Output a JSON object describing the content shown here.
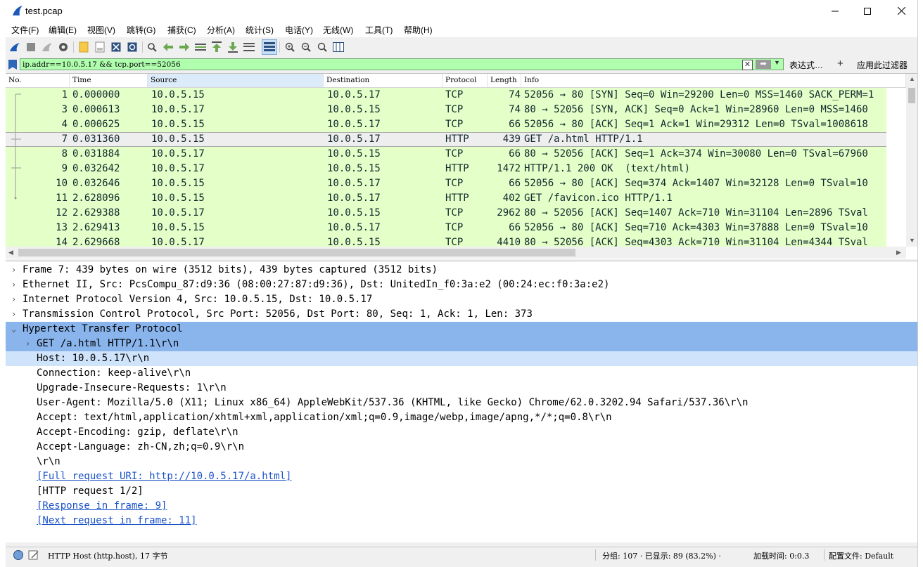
{
  "window": {
    "title": "test.pcap"
  },
  "menu": [
    "文件(F)",
    "编辑(E)",
    "视图(V)",
    "跳转(G)",
    "捕获(C)",
    "分析(A)",
    "统计(S)",
    "电话(Y)",
    "无线(W)",
    "工具(T)",
    "帮助(H)"
  ],
  "toolbar": {
    "icons": [
      "shark-fin-start-icon",
      "stop-square-icon",
      "restart-fin-icon",
      "gear-options-icon",
      "open-folder-icon",
      "save-file-icon",
      "close-file-icon",
      "reload-icon",
      "find-packet-icon",
      "go-back-icon",
      "go-forward-icon",
      "go-to-packet-icon",
      "go-first-icon",
      "go-last-icon",
      "auto-scroll-icon",
      "colorize-icon",
      "zoom-in-icon",
      "zoom-out-icon",
      "zoom-normal-icon",
      "resize-columns-icon"
    ]
  },
  "filter": {
    "value": "ip.addr==10.0.5.17 && tcp.port==52056",
    "expression_label": "表达式…",
    "add_label": "+",
    "apply_label": "应用此过滤器",
    "clear_glyph": "✕",
    "apply_glyph": "➡",
    "dropdown_glyph": "▼"
  },
  "packet_list": {
    "columns": [
      "No.",
      "Time",
      "Source",
      "Destination",
      "Protocol",
      "Length",
      "Info"
    ],
    "rows": [
      {
        "no": "1",
        "time": "0.000000",
        "src": "10.0.5.15",
        "dst": "10.0.5.17",
        "proto": "TCP",
        "len": "74",
        "info": "52056 → 80 [SYN] Seq=0 Win=29200 Len=0 MSS=1460 SACK_PERM=1"
      },
      {
        "no": "3",
        "time": "0.000613",
        "src": "10.0.5.17",
        "dst": "10.0.5.15",
        "proto": "TCP",
        "len": "74",
        "info": "80 → 52056 [SYN, ACK] Seq=0 Ack=1 Win=28960 Len=0 MSS=1460"
      },
      {
        "no": "4",
        "time": "0.000625",
        "src": "10.0.5.15",
        "dst": "10.0.5.17",
        "proto": "TCP",
        "len": "66",
        "info": "52056 → 80 [ACK] Seq=1 Ack=1 Win=29312 Len=0 TSval=1008618"
      },
      {
        "no": "7",
        "time": "0.031360",
        "src": "10.0.5.15",
        "dst": "10.0.5.17",
        "proto": "HTTP",
        "len": "439",
        "info": "GET /a.html HTTP/1.1"
      },
      {
        "no": "8",
        "time": "0.031884",
        "src": "10.0.5.17",
        "dst": "10.0.5.15",
        "proto": "TCP",
        "len": "66",
        "info": "80 → 52056 [ACK] Seq=1 Ack=374 Win=30080 Len=0 TSval=67960"
      },
      {
        "no": "9",
        "time": "0.032642",
        "src": "10.0.5.17",
        "dst": "10.0.5.15",
        "proto": "HTTP",
        "len": "1472",
        "info": "HTTP/1.1 200 OK  (text/html)"
      },
      {
        "no": "10",
        "time": "0.032646",
        "src": "10.0.5.15",
        "dst": "10.0.5.17",
        "proto": "TCP",
        "len": "66",
        "info": "52056 → 80 [ACK] Seq=374 Ack=1407 Win=32128 Len=0 TSval=10"
      },
      {
        "no": "11",
        "time": "2.628096",
        "src": "10.0.5.15",
        "dst": "10.0.5.17",
        "proto": "HTTP",
        "len": "402",
        "info": "GET /favicon.ico HTTP/1.1"
      },
      {
        "no": "12",
        "time": "2.629388",
        "src": "10.0.5.17",
        "dst": "10.0.5.15",
        "proto": "TCP",
        "len": "2962",
        "info": "80 → 52056 [ACK] Seq=1407 Ack=710 Win=31104 Len=2896 TSval"
      },
      {
        "no": "13",
        "time": "2.629413",
        "src": "10.0.5.15",
        "dst": "10.0.5.17",
        "proto": "TCP",
        "len": "66",
        "info": "52056 → 80 [ACK] Seq=710 Ack=4303 Win=37888 Len=0 TSval=10"
      },
      {
        "no": "14",
        "time": "2.629668",
        "src": "10.0.5.17",
        "dst": "10.0.5.15",
        "proto": "TCP",
        "len": "4410",
        "info": "80 → 52056 [ACK] Seq=4303 Ack=710 Win=31104 Len=4344 TSval"
      }
    ],
    "selected_no": "7"
  },
  "details": {
    "lines": [
      {
        "text": "Frame 7: 439 bytes on wire (3512 bits), 439 bytes captured (3512 bits)",
        "chevron": "›",
        "level": 0
      },
      {
        "text": "Ethernet II, Src: PcsCompu_87:d9:36 (08:00:27:87:d9:36), Dst: UnitedIn_f0:3a:e2 (00:24:ec:f0:3a:e2)",
        "chevron": "›",
        "level": 0
      },
      {
        "text": "Internet Protocol Version 4, Src: 10.0.5.15, Dst: 10.0.5.17",
        "chevron": "›",
        "level": 0
      },
      {
        "text": "Transmission Control Protocol, Src Port: 52056, Dst Port: 80, Seq: 1, Ack: 1, Len: 373",
        "chevron": "›",
        "level": 0
      },
      {
        "text": "Hypertext Transfer Protocol",
        "chevron": "⌄",
        "level": 0
      },
      {
        "text": "GET /a.html HTTP/1.1\\r\\n",
        "chevron": "›",
        "level": 1
      },
      {
        "text": "Host: 10.0.5.17\\r\\n",
        "chevron": "",
        "level": 1
      },
      {
        "text": "Connection: keep-alive\\r\\n",
        "chevron": "",
        "level": 1
      },
      {
        "text": "Upgrade-Insecure-Requests: 1\\r\\n",
        "chevron": "",
        "level": 1
      },
      {
        "text": "User-Agent: Mozilla/5.0 (X11; Linux x86_64) AppleWebKit/537.36 (KHTML, like Gecko) Chrome/62.0.3202.94 Safari/537.36\\r\\n",
        "chevron": "",
        "level": 1
      },
      {
        "text": "Accept: text/html,application/xhtml+xml,application/xml;q=0.9,image/webp,image/apng,*/*;q=0.8\\r\\n",
        "chevron": "",
        "level": 1
      },
      {
        "text": "Accept-Encoding: gzip, deflate\\r\\n",
        "chevron": "",
        "level": 1
      },
      {
        "text": "Accept-Language: zh-CN,zh;q=0.9\\r\\n",
        "chevron": "",
        "level": 1
      },
      {
        "text": "\\r\\n",
        "chevron": "",
        "level": 1
      },
      {
        "text": "[Full request URI: http://10.0.5.17/a.html]",
        "chevron": "",
        "level": 1,
        "link": true
      },
      {
        "text": "[HTTP request 1/2]",
        "chevron": "",
        "level": 1
      },
      {
        "text": "[Response in frame: 9]",
        "chevron": "",
        "level": 1,
        "link": true
      },
      {
        "text": "[Next request in frame: 11]",
        "chevron": "",
        "level": 1,
        "link": true
      }
    ]
  },
  "status": {
    "field_info": "HTTP Host (http.host), 17 字节",
    "packets": "分组: 107 · 已显示: 89 (83.2%) ·",
    "load_time": "加载时间: 0:0.3",
    "profile": "配置文件: Default"
  },
  "colors": {
    "row_bg": "#e4ffc7",
    "filter_bg": "#afffaf",
    "selected_tree": "#89b4ec",
    "link": "#1a52c9"
  }
}
